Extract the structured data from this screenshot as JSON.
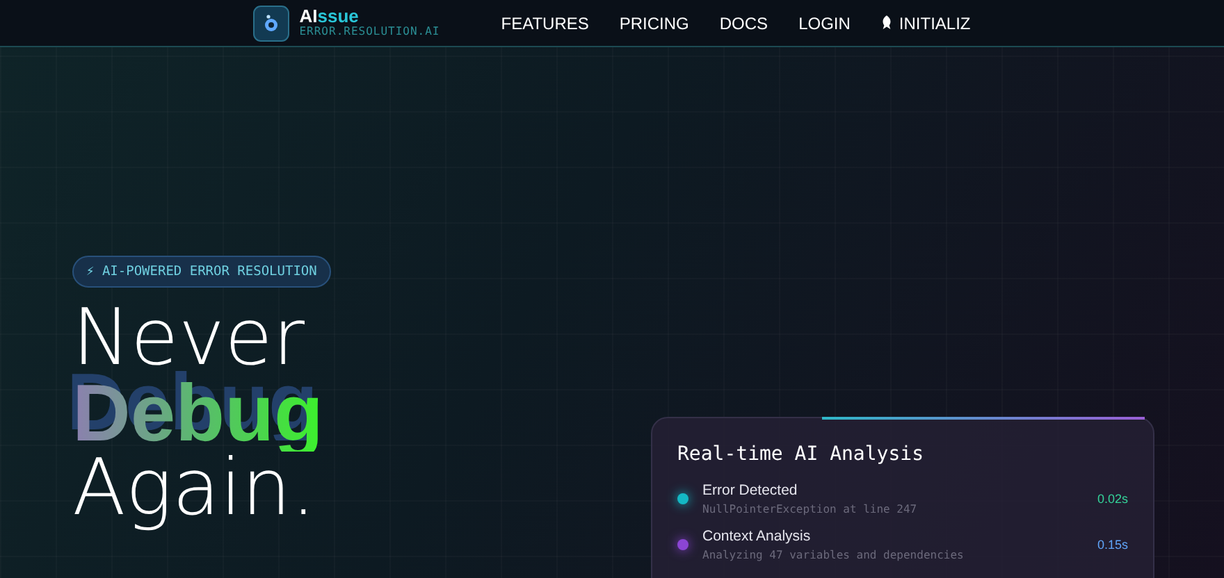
{
  "header": {
    "brand": {
      "name_plain": "AI",
      "name_accent": "ssue",
      "tagline": "ERROR.RESOLUTION.AI"
    },
    "nav": [
      {
        "label": "FEATURES"
      },
      {
        "label": "PRICING"
      },
      {
        "label": "DOCS"
      },
      {
        "label": "LOGIN"
      },
      {
        "label": "INITIALIZ"
      }
    ]
  },
  "hero": {
    "badge": "⚡ AI-POWERED ERROR RESOLUTION",
    "headline": [
      "Never",
      "Debug",
      "Again."
    ]
  },
  "analysis_card": {
    "title": "Real-time AI Analysis",
    "steps": [
      {
        "title": "Error Detected",
        "detail": "NullPointerException at line 247",
        "time": "0.02s",
        "color": "#14b8c4"
      },
      {
        "title": "Context Analysis",
        "detail": "Analyzing 47 variables and dependencies",
        "time": "0.15s",
        "color": "#8b45d4"
      }
    ]
  }
}
